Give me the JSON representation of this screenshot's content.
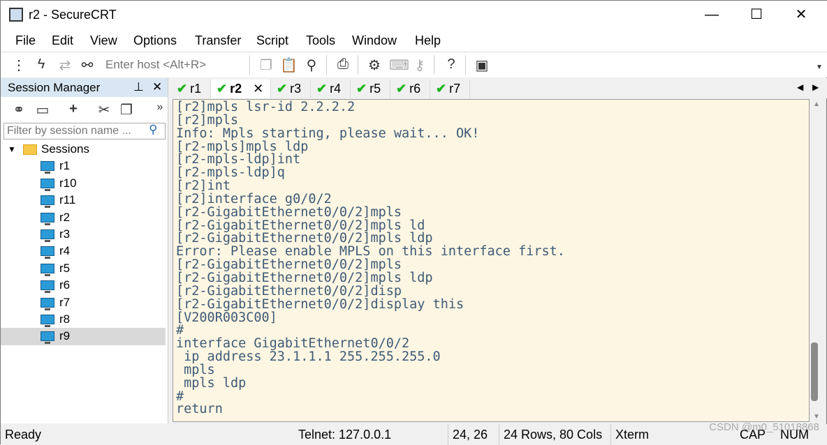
{
  "window": {
    "title": "r2 - SecureCRT"
  },
  "menu": [
    "File",
    "Edit",
    "View",
    "Options",
    "Transfer",
    "Script",
    "Tools",
    "Window",
    "Help"
  ],
  "toolbar": {
    "host_placeholder": "Enter host <Alt+R>"
  },
  "session_manager": {
    "title": "Session Manager",
    "filter_placeholder": "Filter by session name ...",
    "root": "Sessions",
    "sessions": [
      "r1",
      "r10",
      "r11",
      "r2",
      "r3",
      "r4",
      "r5",
      "r6",
      "r7",
      "r8",
      "r9"
    ],
    "selected": "r9"
  },
  "tabs": [
    {
      "label": "r1"
    },
    {
      "label": "r2",
      "active": true
    },
    {
      "label": "r3"
    },
    {
      "label": "r4"
    },
    {
      "label": "r5"
    },
    {
      "label": "r6"
    },
    {
      "label": "r7"
    }
  ],
  "terminal": {
    "lines": [
      "[r2]mpls lsr-id 2.2.2.2",
      "[r2]mpls",
      "Info: Mpls starting, please wait... OK!",
      "[r2-mpls]mpls ldp",
      "[r2-mpls-ldp]int",
      "[r2-mpls-ldp]q",
      "[r2]int",
      "[r2]interface g0/0/2",
      "[r2-GigabitEthernet0/0/2]mpls",
      "[r2-GigabitEthernet0/0/2]mpls ld",
      "[r2-GigabitEthernet0/0/2]mpls ldp",
      "Error: Please enable MPLS on this interface first.",
      "[r2-GigabitEthernet0/0/2]mpls",
      "[r2-GigabitEthernet0/0/2]mpls ldp",
      "[r2-GigabitEthernet0/0/2]disp",
      "[r2-GigabitEthernet0/0/2]display this",
      "[V200R003C00]",
      "#",
      "interface GigabitEthernet0/0/2",
      " ip address 23.1.1.1 255.255.255.0",
      " mpls",
      " mpls ldp",
      "#",
      "return"
    ]
  },
  "status": {
    "ready": "Ready",
    "protocol": "Telnet: 127.0.0.1",
    "cursor": "24,  26",
    "size": "24 Rows, 80 Cols",
    "emulation": "Xterm",
    "caps": "CAP",
    "num": "NUM"
  },
  "watermark": "CSDN @m0_51018868",
  "colors": {
    "terminal_bg": "#fdf6e3",
    "terminal_fg": "#3e5a76",
    "check": "#1db51d"
  }
}
